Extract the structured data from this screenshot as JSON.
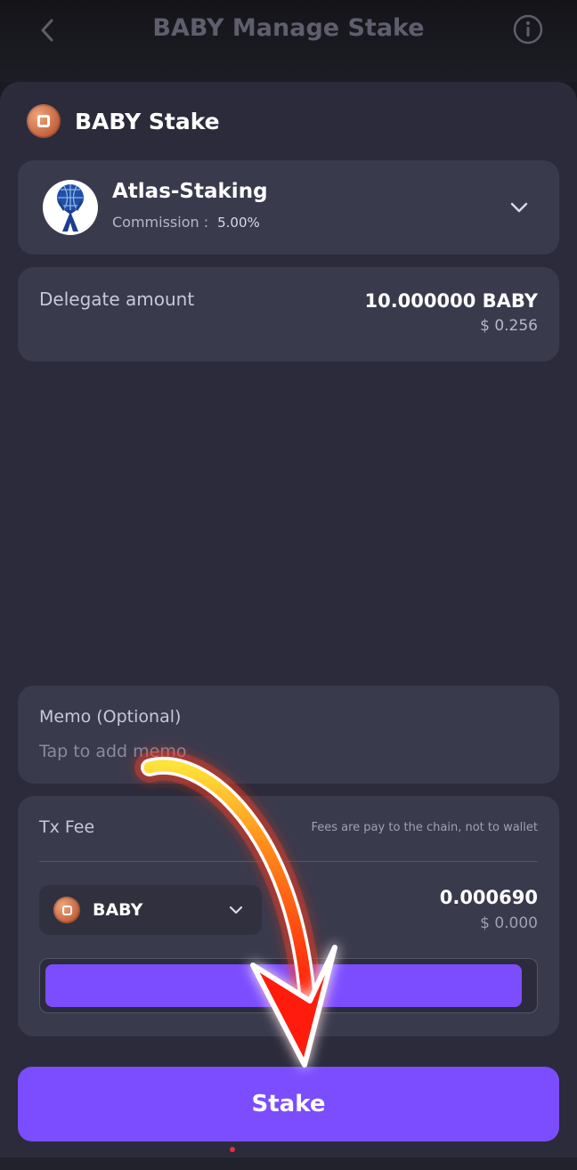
{
  "header": {
    "title": "BABY Manage Stake",
    "back_icon": "chevron-left-icon",
    "info_icon": "info-icon"
  },
  "sheet": {
    "title": "BABY Stake",
    "coin_icon": "baby-coin-icon"
  },
  "validator": {
    "name": "Atlas-Staking",
    "commission_label": "Commission :",
    "commission_value": "5.00%"
  },
  "delegate": {
    "label": "Delegate amount",
    "amount": "10.000000 BABY",
    "usd": "$ 0.256"
  },
  "memo": {
    "label": "Memo (Optional)",
    "placeholder": "Tap to add memo"
  },
  "fee": {
    "label": "Tx Fee",
    "note": "Fees are pay to the chain, not to wallet",
    "token": "BABY",
    "amount": "0.000690",
    "usd": "$ 0.000",
    "tier_fill_fraction": 0.98
  },
  "actions": {
    "stake_label": "Stake"
  },
  "colors": {
    "accent": "#7b4dff",
    "card": "#3a3a4d",
    "sheet": "#2b2b3b",
    "coin": "#c2603a",
    "annotation_arrow": "#ff2a12"
  }
}
